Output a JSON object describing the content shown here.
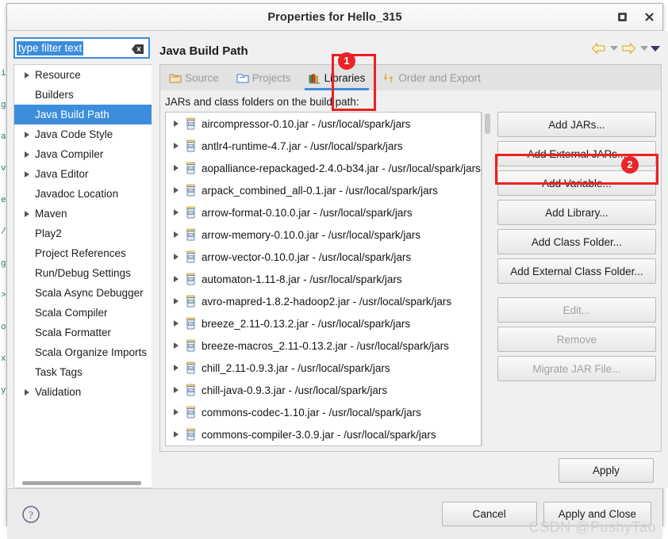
{
  "window": {
    "title": "Properties for Hello_315",
    "maximize_glyph": "■",
    "close_glyph": "✕"
  },
  "filter": {
    "value": "type filter text",
    "placeholder": "type filter text"
  },
  "sidebar": {
    "items": [
      {
        "label": "Resource",
        "expandable": true,
        "selected": false
      },
      {
        "label": "Builders",
        "expandable": false,
        "selected": false
      },
      {
        "label": "Java Build Path",
        "expandable": false,
        "selected": true
      },
      {
        "label": "Java Code Style",
        "expandable": true,
        "selected": false
      },
      {
        "label": "Java Compiler",
        "expandable": true,
        "selected": false
      },
      {
        "label": "Java Editor",
        "expandable": true,
        "selected": false
      },
      {
        "label": "Javadoc Location",
        "expandable": false,
        "selected": false
      },
      {
        "label": "Maven",
        "expandable": true,
        "selected": false
      },
      {
        "label": "Play2",
        "expandable": false,
        "selected": false
      },
      {
        "label": "Project References",
        "expandable": false,
        "selected": false
      },
      {
        "label": "Run/Debug Settings",
        "expandable": false,
        "selected": false
      },
      {
        "label": "Scala Async Debugger",
        "expandable": false,
        "selected": false
      },
      {
        "label": "Scala Compiler",
        "expandable": false,
        "selected": false
      },
      {
        "label": "Scala Formatter",
        "expandable": false,
        "selected": false
      },
      {
        "label": "Scala Organize Imports",
        "expandable": false,
        "selected": false
      },
      {
        "label": "Task Tags",
        "expandable": false,
        "selected": false
      },
      {
        "label": "Validation",
        "expandable": true,
        "selected": false
      }
    ]
  },
  "page": {
    "title": "Java Build Path"
  },
  "nav": {
    "back_icon": "back-arrow-icon",
    "back_menu_icon": "chevron-down-icon",
    "forward_icon": "forward-arrow-icon",
    "forward_menu_icon": "chevron-down-icon",
    "view_menu_icon": "chevron-down-icon"
  },
  "tabs": [
    {
      "label": "Source",
      "icon": "source-folder-icon",
      "active": false
    },
    {
      "label": "Projects",
      "icon": "projects-folder-icon",
      "active": false
    },
    {
      "label": "Libraries",
      "icon": "libraries-books-icon",
      "active": true
    },
    {
      "label": "Order and Export",
      "icon": "order-export-icon",
      "active": false
    }
  ],
  "libraries": {
    "caption": "JARs and class folders on the build path:",
    "entries": [
      "aircompressor-0.10.jar - /usr/local/spark/jars",
      "antlr4-runtime-4.7.jar - /usr/local/spark/jars",
      "aopalliance-repackaged-2.4.0-b34.jar - /usr/local/spark/jars",
      "arpack_combined_all-0.1.jar - /usr/local/spark/jars",
      "arrow-format-0.10.0.jar - /usr/local/spark/jars",
      "arrow-memory-0.10.0.jar - /usr/local/spark/jars",
      "arrow-vector-0.10.0.jar - /usr/local/spark/jars",
      "automaton-1.11-8.jar - /usr/local/spark/jars",
      "avro-mapred-1.8.2-hadoop2.jar - /usr/local/spark/jars",
      "breeze_2.11-0.13.2.jar - /usr/local/spark/jars",
      "breeze-macros_2.11-0.13.2.jar - /usr/local/spark/jars",
      "chill_2.11-0.9.3.jar - /usr/local/spark/jars",
      "chill-java-0.9.3.jar - /usr/local/spark/jars",
      "commons-codec-1.10.jar - /usr/local/spark/jars",
      "commons-compiler-3.0.9.jar - /usr/local/spark/jars"
    ]
  },
  "side_buttons": [
    {
      "label": "Add JARs...",
      "disabled": false
    },
    {
      "label": "Add External JARs...",
      "disabled": false
    },
    {
      "label": "Add Variable...",
      "disabled": false
    },
    {
      "label": "Add Library...",
      "disabled": false
    },
    {
      "label": "Add Class Folder...",
      "disabled": false
    },
    {
      "label": "Add External Class Folder...",
      "disabled": false
    },
    {
      "label": "Edit...",
      "disabled": true
    },
    {
      "label": "Remove",
      "disabled": true
    },
    {
      "label": "Migrate JAR File...",
      "disabled": true
    }
  ],
  "apply": {
    "label": "Apply"
  },
  "footer": {
    "help_icon": "help-question-icon",
    "cancel_label": "Cancel",
    "apply_close_label": "Apply and Close"
  },
  "annotations": [
    {
      "number": "1",
      "target": "tab-libraries"
    },
    {
      "number": "2",
      "target": "button-add-external-jars"
    }
  ],
  "watermark": "CSDN @PushyTao",
  "colors": {
    "accent": "#3c8ddb",
    "annotation": "#e8242a",
    "dialog_bg": "#f0f0f0",
    "list_bg": "#ffffff"
  },
  "editor_sliver_lines": [
    "i",
    "g",
    "a",
    "v",
    "e",
    "/",
    "g",
    ">",
    "o",
    "x",
    "y"
  ]
}
